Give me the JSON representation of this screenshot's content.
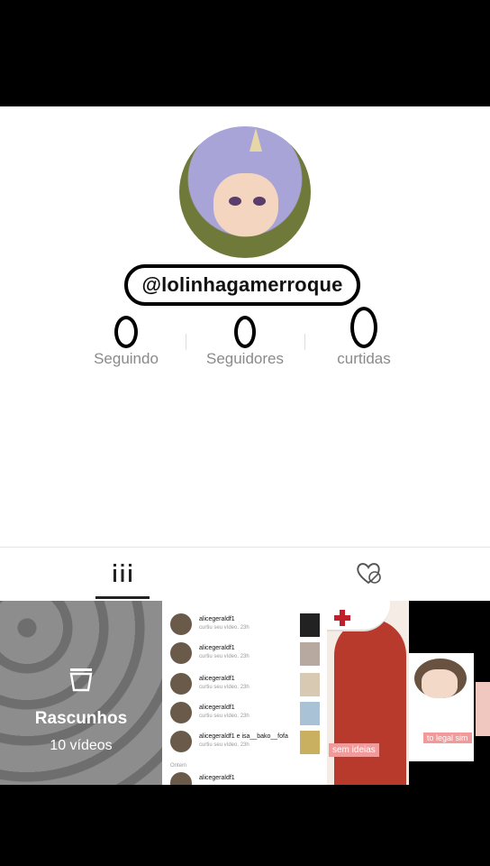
{
  "profile": {
    "username": "@lolinhagamerroque",
    "stats": [
      {
        "value": "0",
        "label": "Seguindo"
      },
      {
        "value": "0",
        "label": "Seguidores"
      },
      {
        "value": "0",
        "label": "curtidas"
      }
    ]
  },
  "tabs": {
    "videos_icon": "grid-icon",
    "liked_icon": "hidden-heart-icon",
    "active": "videos"
  },
  "drafts": {
    "title": "Rascunhos",
    "count_label": "10 vídeos"
  },
  "notifications_thumb": {
    "rows": [
      {
        "name": "alicegeraldf1",
        "text": "curtiu seu vídeo. 23h"
      },
      {
        "name": "alicegeraldf1",
        "text": "curtiu seu vídeo. 23h"
      },
      {
        "name": "alicegeraldf1",
        "text": "curtiu seu vídeo. 23h"
      },
      {
        "name": "alicegeraldf1",
        "text": "curtiu seu vídeo. 23h"
      },
      {
        "name": "alicegeraldf1 e isa__bako__fofa",
        "text": "curtiu seu vídeo. 23h"
      }
    ],
    "section": "Ontem",
    "last_name": "alicegeraldf1"
  },
  "nurse_thumb": {
    "caption": "sem ideias"
  },
  "wolf_thumb": {
    "caption": "to legal sim"
  },
  "colors": {
    "background": "#000000",
    "page": "#ffffff",
    "stat_label": "#8a8a8a",
    "tag": "#f29a9a"
  }
}
